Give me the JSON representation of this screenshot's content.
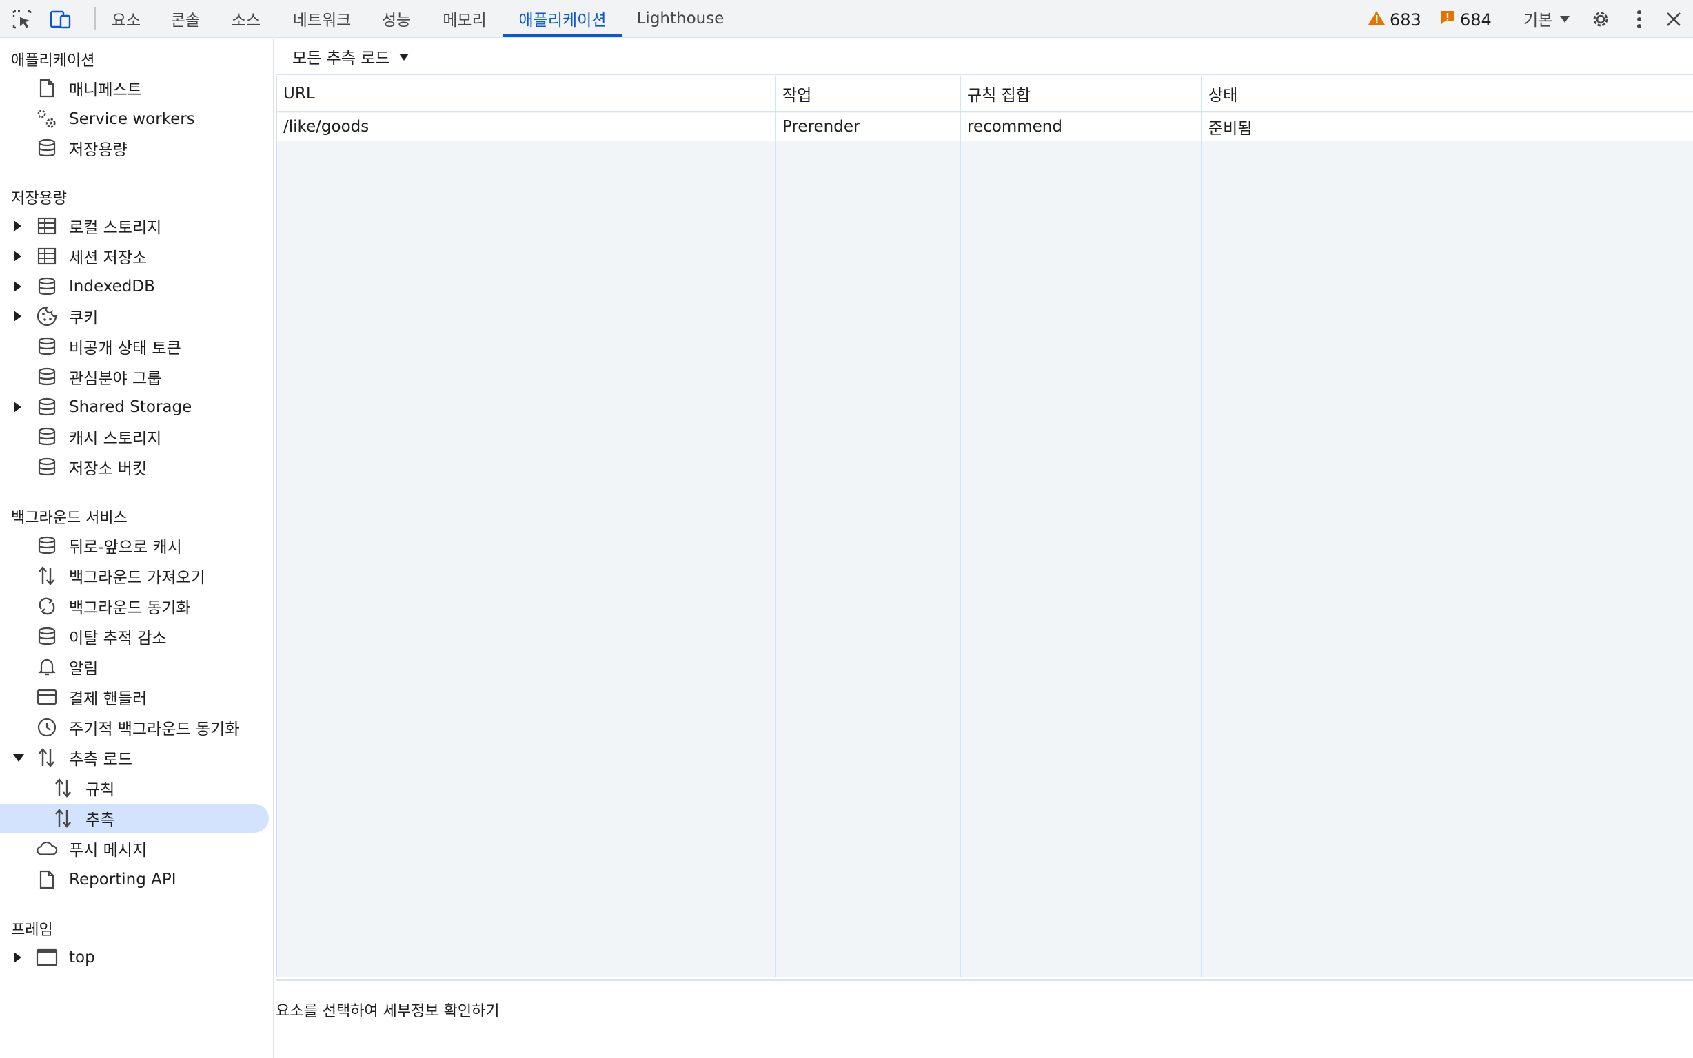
{
  "toolbar": {
    "inspect_icon": "inspect-element-icon",
    "device_icon": "device-toolbar-icon",
    "tabs": [
      {
        "label": "요소"
      },
      {
        "label": "콘솔"
      },
      {
        "label": "소스"
      },
      {
        "label": "네트워크"
      },
      {
        "label": "성능"
      },
      {
        "label": "메모리"
      },
      {
        "label": "애플리케이션"
      },
      {
        "label": "Lighthouse"
      }
    ],
    "active_tab": "애플리케이션",
    "warnings_count": "683",
    "issues_count": "684",
    "throttle_label": "기본",
    "accent_color": "#0b57d0",
    "warning_color": "#e37400"
  },
  "sidebar": {
    "sections": [
      {
        "title": "애플리케이션"
      },
      {
        "title": "저장용량"
      },
      {
        "title": "백그라운드 서비스"
      },
      {
        "title": "프레임"
      }
    ],
    "app_items": [
      {
        "label": "매니페스트",
        "icon": "file-icon"
      },
      {
        "label": "Service workers",
        "icon": "gears-icon"
      },
      {
        "label": "저장용량",
        "icon": "database-icon"
      }
    ],
    "storage_items": [
      {
        "label": "로컬 스토리지",
        "icon": "table-icon"
      },
      {
        "label": "세션 저장소",
        "icon": "table-icon"
      },
      {
        "label": "IndexedDB",
        "icon": "database-icon"
      },
      {
        "label": "쿠키",
        "icon": "cookie-icon"
      },
      {
        "label": "비공개 상태 토큰",
        "icon": "database-icon"
      },
      {
        "label": "관심분야 그룹",
        "icon": "database-icon"
      },
      {
        "label": "Shared Storage",
        "icon": "database-icon"
      },
      {
        "label": "캐시 스토리지",
        "icon": "database-icon"
      },
      {
        "label": "저장소 버킷",
        "icon": "database-icon"
      }
    ],
    "bg_items": [
      {
        "label": "뒤로-앞으로 캐시",
        "icon": "database-icon"
      },
      {
        "label": "백그라운드 가져오기",
        "icon": "updown-arrows-icon"
      },
      {
        "label": "백그라운드 동기화",
        "icon": "sync-icon"
      },
      {
        "label": "이탈 추적 감소",
        "icon": "database-icon"
      },
      {
        "label": "알림",
        "icon": "bell-icon"
      },
      {
        "label": "결제 핸들러",
        "icon": "credit-card-icon"
      },
      {
        "label": "주기적 백그라운드 동기화",
        "icon": "clock-icon"
      },
      {
        "label": "추측 로드",
        "icon": "updown-arrows-icon"
      },
      {
        "label": "규칙",
        "icon": "updown-arrows-icon"
      },
      {
        "label": "추측",
        "icon": "updown-arrows-icon"
      },
      {
        "label": "푸시 메시지",
        "icon": "cloud-icon"
      },
      {
        "label": "Reporting API",
        "icon": "file-icon"
      }
    ],
    "frame_items": [
      {
        "label": "top",
        "icon": "frame-icon"
      }
    ],
    "selected": "추측",
    "selected_bg": "#d3e3fd"
  },
  "main": {
    "filter_label": "모든 추측 로드",
    "columns": [
      "URL",
      "작업",
      "규칙 집합",
      "상태"
    ],
    "rows": [
      [
        "/like/goods",
        "Prerender",
        "recommend",
        "준비됨"
      ]
    ],
    "details_placeholder": "요소를 선택하여 세부정보 확인하기"
  }
}
